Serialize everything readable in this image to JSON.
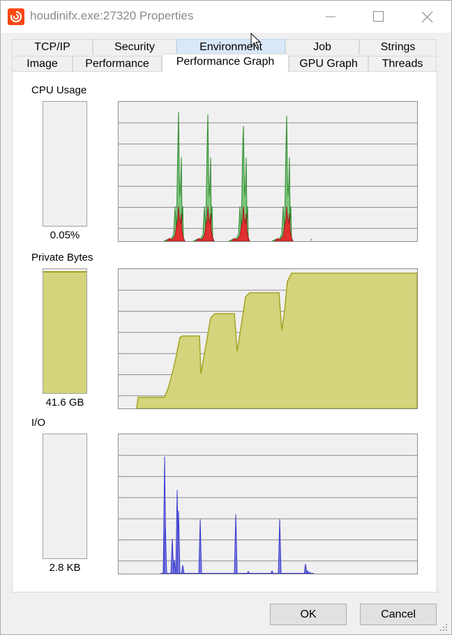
{
  "window": {
    "title": "houdinifx.exe:27320 Properties"
  },
  "tabs": {
    "row1": [
      "TCP/IP",
      "Security",
      "Environment",
      "Job",
      "Strings"
    ],
    "row2": [
      "Image",
      "Performance",
      "Performance Graph",
      "GPU Graph",
      "Threads"
    ],
    "active": "Performance Graph",
    "hovered": "Environment"
  },
  "sections": {
    "cpu": {
      "label": "CPU Usage",
      "value": "0.05%",
      "meter_fill": 0.0005
    },
    "private_bytes": {
      "label": "Private Bytes",
      "value": "41.6 GB",
      "meter_fill": 0.97
    },
    "io": {
      "label": "I/O",
      "value": "2.8  KB",
      "meter_fill": 0.0
    }
  },
  "buttons": {
    "ok": "OK",
    "cancel": "Cancel"
  },
  "colors": {
    "cpu_total": "#52a852",
    "cpu_kernel": "#e03030",
    "private_bytes": "#d4d47c",
    "io": "#3a3ad0",
    "grid": "#8c8c8c"
  }
}
